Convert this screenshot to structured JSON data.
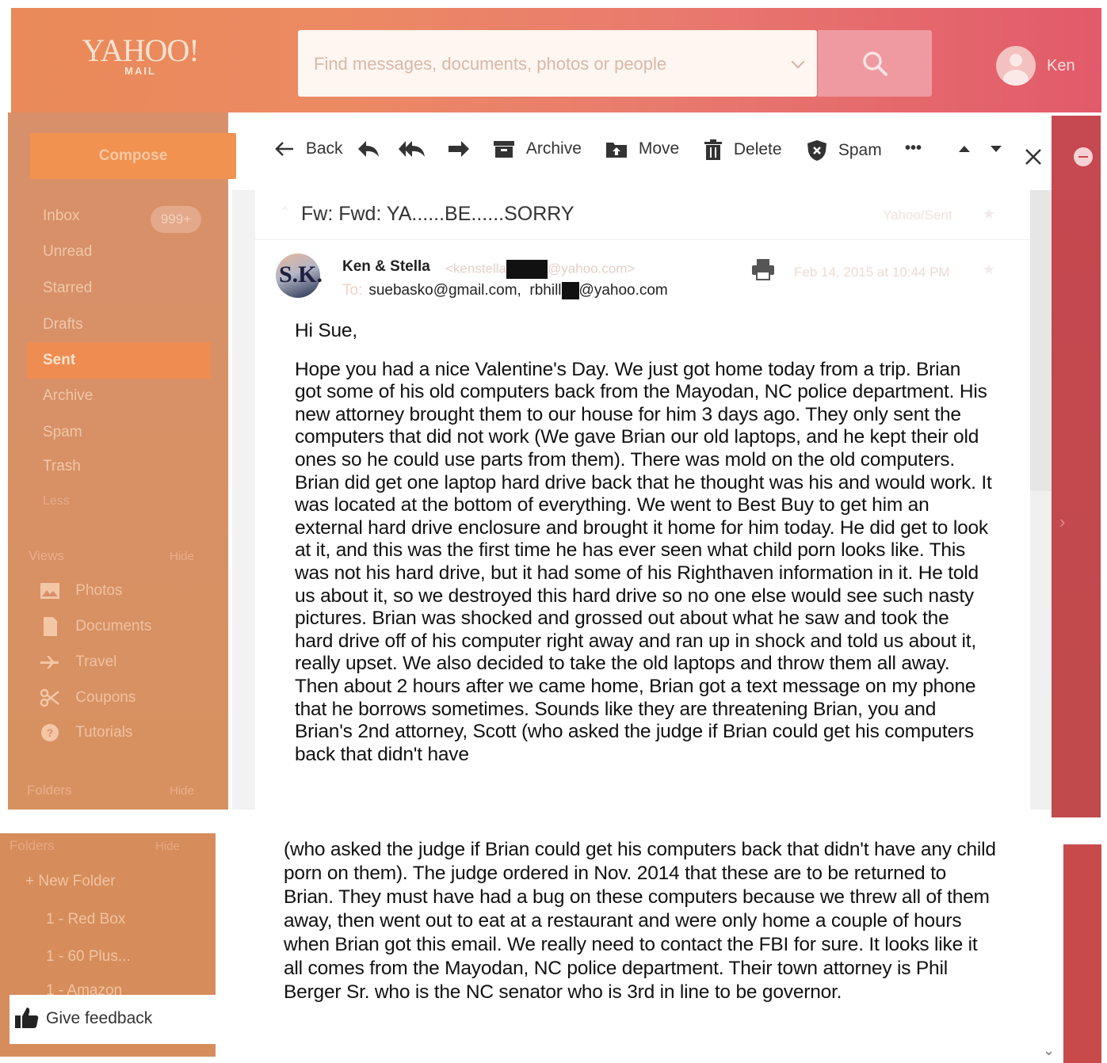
{
  "app": {
    "logo_main": "YAHOO!",
    "logo_sub": "MAIL",
    "search_placeholder": "Find messages, documents, photos or people",
    "user_name": "Ken"
  },
  "sidebar": {
    "compose_label": "Compose",
    "items": [
      {
        "label": "Inbox",
        "badge": "999+"
      },
      {
        "label": "Unread"
      },
      {
        "label": "Starred"
      },
      {
        "label": "Drafts"
      },
      {
        "label": "Sent"
      },
      {
        "label": "Archive"
      },
      {
        "label": "Spam"
      },
      {
        "label": "Trash"
      },
      {
        "label": "Less"
      }
    ],
    "views_label": "Views",
    "views_hide": "Hide",
    "views": [
      {
        "label": "Photos",
        "icon": "photo-icon"
      },
      {
        "label": "Documents",
        "icon": "document-icon"
      },
      {
        "label": "Travel",
        "icon": "plane-icon"
      },
      {
        "label": "Coupons",
        "icon": "scissors-icon"
      },
      {
        "label": "Tutorials",
        "icon": "help-icon"
      }
    ],
    "folders_label": "Folders",
    "folders_hide": "Hide",
    "new_folder": "+ New Folder",
    "folders": [
      "1 - Red Box",
      "1 - 60 Plus...",
      "1 - Amazon"
    ],
    "feedback_label": "Give feedback"
  },
  "toolbar": {
    "back": "Back",
    "archive": "Archive",
    "move": "Move",
    "delete": "Delete",
    "spam": "Spam",
    "more": "•••"
  },
  "message": {
    "subject": "Fw: Fwd: YA......BE......SORRY",
    "folder": "Yahoo/Sent",
    "sender_initials": "S.K.",
    "sender_name": "Ken & Stella",
    "sender_email_start": "<kenstella",
    "sender_email_end": "@yahoo.com>",
    "to_label": "To:",
    "to_first": "suebasko@gmail.com,",
    "to_second_start": "rbhill",
    "to_second_end": "@yahoo.com",
    "date": "Feb 14, 2015 at 10:44 PM",
    "greeting": "Hi Sue,",
    "body_upper": "Hope you had a nice Valentine's Day.   We just got home today from a trip. Brian got some of his old computers back from the Mayodan, NC police department.   His new attorney brought them to our house for him 3 days ago.   They only sent the computers that did not work  (We gave Brian our old laptops, and he kept their old ones so he could use parts from them). There was mold on the old computers.  Brian did get one laptop hard drive back that he thought was his and would work.   It was located at the bottom of everything.   We went to Best Buy to get him an external hard drive enclosure and brought it home for him today.   He did get to look at it, and this was the first time he has ever seen what child porn looks like.   This was not his hard drive, but it had some of his Righthaven information in it. He told us about it, so we destroyed this hard drive so no one else would see such nasty pictures.   Brian was shocked and grossed out about what he saw and took the hard drive off of his computer right away and ran up in shock and told us about it, really upset.  We also decided to take the old laptops and throw them all away.   Then about 2 hours after we came home, Brian got a text message on my phone that he borrows sometimes. Sounds like they are threatening Brian, you and Brian's 2nd attorney, Scott (who asked the judge if Brian could get his computers back that didn't have",
    "body_lower": "(who asked the judge if Brian could get his computers back that didn't have any child porn on them).  The judge ordered in Nov. 2014 that these are to be returned to Brian.  They must have had a bug on these computers because we threw all of them away, then went out to eat at a restaurant and were only home a couple of hours when Brian got this email.   We really need to contact the FBI for sure.    It looks like it all comes from the Mayodan, NC police department.  Their town attorney is Phil Berger Sr. who is the NC senator who is 3rd in line to be governor."
  },
  "colors": {
    "header_start": "#e98a58",
    "header_end": "#e25a6b",
    "sidebar": "#d8906a",
    "compose": "#f19250",
    "right_rail": "#c64850"
  }
}
